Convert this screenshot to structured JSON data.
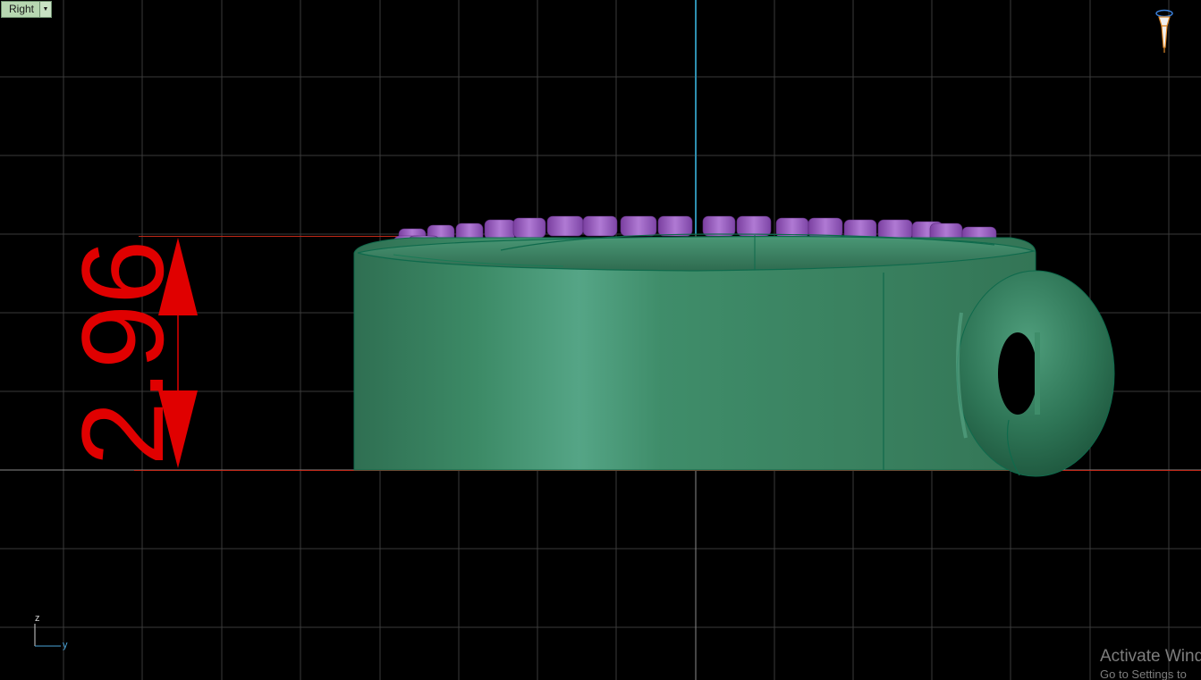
{
  "viewport": {
    "view_name": "Right",
    "background_color": "#000000",
    "grid_color": "#3a3a3a",
    "axis_line_color": "#2e8fb0",
    "ground_line_color": "#c02818"
  },
  "dimension": {
    "value": "2.96",
    "color": "#e00000"
  },
  "model": {
    "body_color": "#3f8f6a",
    "edge_color": "#0f6a4c",
    "stone_color": "#9a5bc2"
  },
  "axis_triad": {
    "z_label": "z",
    "y_label": "y"
  },
  "icons": {
    "camera": "camera-gizmo-icon",
    "dropdown": "chevron-down-icon"
  },
  "activation_notice": {
    "title": "Activate Wind",
    "subtitle": "Go to Settings to"
  }
}
